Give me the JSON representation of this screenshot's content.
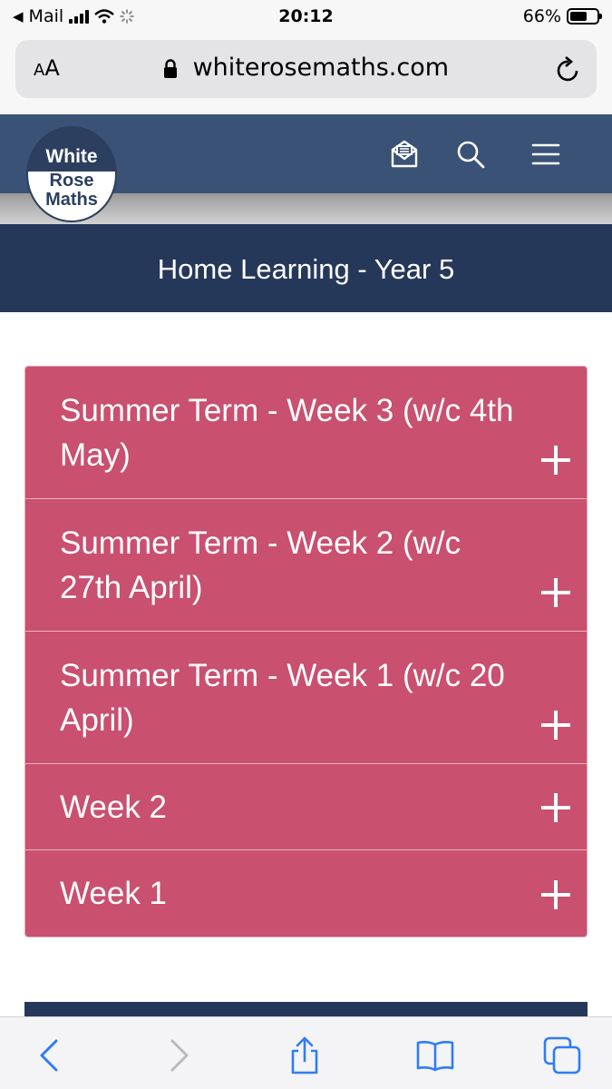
{
  "status_bar": {
    "back_app": "Mail",
    "time": "20:12",
    "battery": "66%",
    "battery_level": 0.66
  },
  "browser": {
    "text_size_label_large": "A",
    "text_size_label_small": "A",
    "url": "whiterosemaths.com"
  },
  "logo": {
    "line1": "White",
    "line2": "Rose",
    "line3": "Maths"
  },
  "header": {
    "icons": [
      "mail-icon",
      "search-icon",
      "menu-icon"
    ]
  },
  "page": {
    "title": "Home Learning - Year 5"
  },
  "accordion": {
    "items": [
      {
        "label": "Summer Term - Week 3 (w/c 4th May)"
      },
      {
        "label": "Summer Term - Week 2 (w/c 27th April)"
      },
      {
        "label": "Summer Term - Week 1 (w/c 20 April)"
      },
      {
        "label": "Week 2"
      },
      {
        "label": "Week 1"
      }
    ]
  },
  "colors": {
    "header": "#3a5275",
    "title_band": "#26385a",
    "accordion": "#c9506e",
    "toolbar_icons": "#2f7cf6"
  },
  "toolbar": {
    "icons": [
      "back-icon",
      "forward-icon",
      "share-icon",
      "bookmarks-icon",
      "tabs-icon"
    ]
  }
}
